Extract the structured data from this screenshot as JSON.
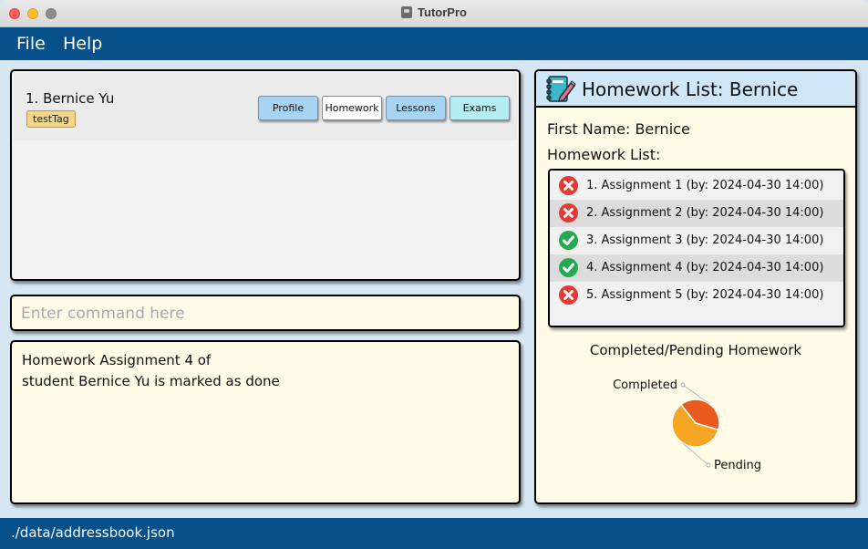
{
  "window": {
    "title": "TutorPro"
  },
  "menu": {
    "file": "File",
    "help": "Help"
  },
  "person_list": [
    {
      "index_name": "1.  Bernice Yu",
      "tag": "testTag"
    }
  ],
  "tabs": {
    "profile": "Profile",
    "homework": "Homework",
    "lessons": "Lessons",
    "exams": "Exams"
  },
  "command": {
    "placeholder": "Enter command here",
    "value": ""
  },
  "result": {
    "line1": "Homework Assignment 4 of",
    "line2": "student Bernice Yu is marked as done"
  },
  "detail": {
    "title": "Homework List: Bernice",
    "first_name": "First Name: Bernice",
    "list_label": "Homework List:",
    "homework": [
      {
        "text": "1.  Assignment 1 (by: 2024-04-30 14:00)",
        "status": "pending"
      },
      {
        "text": "2.  Assignment 2 (by: 2024-04-30 14:00)",
        "status": "pending"
      },
      {
        "text": "3.  Assignment 3 (by: 2024-04-30 14:00)",
        "status": "done"
      },
      {
        "text": "4.  Assignment 4 (by: 2024-04-30 14:00)",
        "status": "done"
      },
      {
        "text": "5.  Assignment 5 (by: 2024-04-30 14:00)",
        "status": "pending"
      }
    ]
  },
  "chart_data": {
    "type": "pie",
    "title": "Completed/Pending Homework",
    "slices": [
      {
        "label": "Pending",
        "value": 3,
        "color": "#f5a623"
      },
      {
        "label": "Completed",
        "value": 2,
        "color": "#ea5a1e"
      }
    ]
  },
  "status_bar": {
    "path": "./data/addressbook.json"
  },
  "colors": {
    "accent": "#08508a",
    "panel_bg": "#fffbe6",
    "header_bg": "#cfe6f6"
  }
}
